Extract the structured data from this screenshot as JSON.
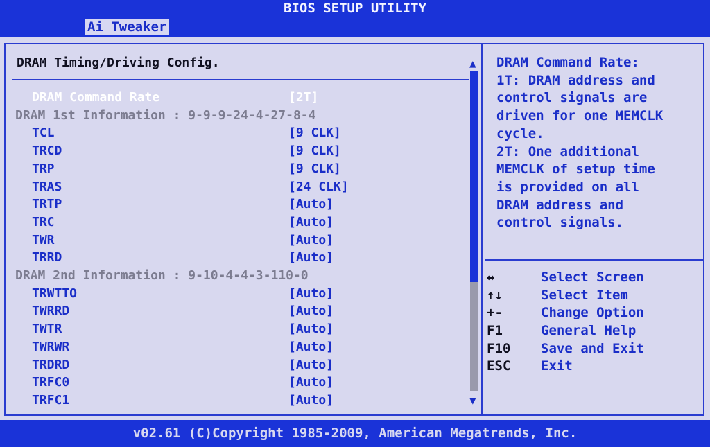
{
  "header": {
    "title": "BIOS SETUP UTILITY"
  },
  "menu": {
    "active_tab": "Ai Tweaker"
  },
  "left_panel": {
    "title": "DRAM Timing/Driving Config.",
    "rows": [
      {
        "type": "setting",
        "label": "DRAM Command Rate",
        "value": "[2T]",
        "selected": true
      },
      {
        "type": "info",
        "label": "DRAM 1st Information : 9-9-9-24-4-27-8-4"
      },
      {
        "type": "setting",
        "label": "TCL",
        "value": "[9 CLK]"
      },
      {
        "type": "setting",
        "label": "TRCD",
        "value": "[9 CLK]"
      },
      {
        "type": "setting",
        "label": "TRP",
        "value": "[9 CLK]"
      },
      {
        "type": "setting",
        "label": "TRAS",
        "value": "[24 CLK]"
      },
      {
        "type": "setting",
        "label": "TRTP",
        "value": "[Auto]"
      },
      {
        "type": "setting",
        "label": "TRC",
        "value": "[Auto]"
      },
      {
        "type": "setting",
        "label": "TWR",
        "value": "[Auto]"
      },
      {
        "type": "setting",
        "label": "TRRD",
        "value": "[Auto]"
      },
      {
        "type": "info",
        "label": "DRAM 2nd Information : 9-10-4-4-3-110-0"
      },
      {
        "type": "setting",
        "label": "TRWTTO",
        "value": "[Auto]"
      },
      {
        "type": "setting",
        "label": "TWRRD",
        "value": "[Auto]"
      },
      {
        "type": "setting",
        "label": "TWTR",
        "value": "[Auto]"
      },
      {
        "type": "setting",
        "label": "TWRWR",
        "value": "[Auto]"
      },
      {
        "type": "setting",
        "label": "TRDRD",
        "value": "[Auto]"
      },
      {
        "type": "setting",
        "label": "TRFC0",
        "value": "[Auto]"
      },
      {
        "type": "setting",
        "label": "TRFC1",
        "value": "[Auto]"
      }
    ],
    "scrollbar": {
      "up_glyph": "▲",
      "down_glyph": "▼",
      "thumb_fraction": 0.66
    }
  },
  "help": {
    "lines": [
      "DRAM Command Rate:",
      "1T: DRAM address and",
      "control signals are",
      "driven for one MEMCLK",
      "cycle.",
      "2T: One additional",
      "MEMCLK of setup time",
      "is provided on all",
      "DRAM address and",
      "control signals."
    ]
  },
  "keys": [
    {
      "key": "↔",
      "desc": "Select Screen"
    },
    {
      "key": "↑↓",
      "desc": "Select Item"
    },
    {
      "key": "+-",
      "desc": "Change Option"
    },
    {
      "key": "F1",
      "desc": "General Help"
    },
    {
      "key": "F10",
      "desc": "Save and Exit"
    },
    {
      "key": "ESC",
      "desc": "Exit"
    }
  ],
  "footer": {
    "copyright": "v02.61 (C)Copyright 1985-2009, American Megatrends, Inc."
  }
}
